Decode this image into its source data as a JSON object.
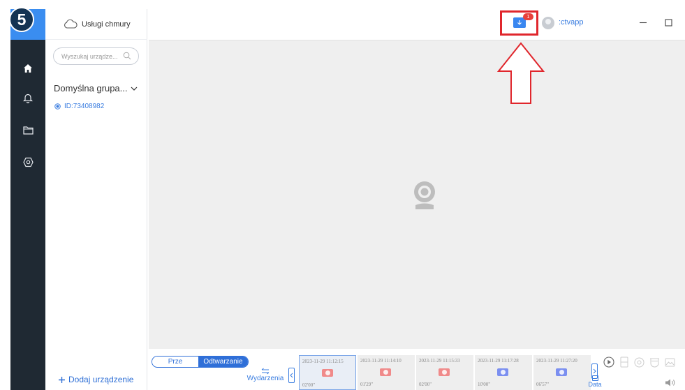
{
  "step_badge": "5",
  "sidebar": {
    "cloud_label": "Usługi chmury",
    "search_placeholder": "Wyszukaj urządze...",
    "group_label": "Domyślna grupa...",
    "device_id": "ID:73408982",
    "add_device_label": "Dodaj urządzenie",
    "rail_icons": [
      "home-icon",
      "bell-icon",
      "folder-icon",
      "settings-icon"
    ]
  },
  "header": {
    "download_badge": "1",
    "username": ":ctvapp"
  },
  "playback": {
    "mode_tabs": [
      "Prze",
      "Odtwarzanie"
    ],
    "active_tab": "Odtwarzanie",
    "events_label": "Wydarzenia",
    "data_label": "Data",
    "clips": [
      {
        "timestamp": "2023-11-29 11:12:15",
        "duration": "02'00\"",
        "kind": "alarm",
        "selected": true
      },
      {
        "timestamp": "2023-11-29 11:14:10",
        "duration": "01'29\"",
        "kind": "alarm",
        "selected": false
      },
      {
        "timestamp": "2023-11-29 11:15:33",
        "duration": "02'00\"",
        "kind": "alarm",
        "selected": false
      },
      {
        "timestamp": "2023-11-29 11:17:28",
        "duration": "10'00\"",
        "kind": "motion",
        "selected": false
      },
      {
        "timestamp": "2023-11-29 11:27:20",
        "duration": "06'57\"",
        "kind": "motion",
        "selected": false
      }
    ],
    "clip_colors": {
      "alarm": "#f08a8a",
      "motion": "#7b8ff0"
    }
  },
  "colors": {
    "accent": "#3a87f0",
    "rail": "#1f2933",
    "highlight": "#e0262c"
  }
}
